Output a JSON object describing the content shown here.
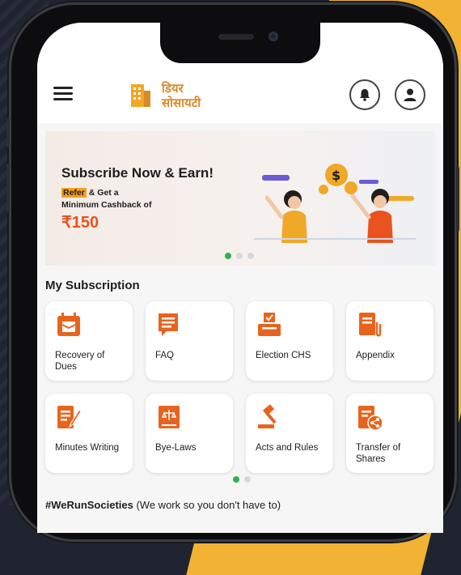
{
  "app": {
    "logo_line1": "डियर",
    "logo_line2": "सोसायटी"
  },
  "banner": {
    "title": "Subscribe Now & Earn!",
    "refer_label": "Refer",
    "line1_rest": " & Get a",
    "line2": "Minimum Cashback of",
    "amount": "₹150"
  },
  "subscription": {
    "heading": "My Subscription",
    "tiles": [
      {
        "label": "Recovery of Dues",
        "icon": "box-calendar-icon"
      },
      {
        "label": "FAQ",
        "icon": "chat-list-icon"
      },
      {
        "label": "Election CHS",
        "icon": "ballot-box-icon"
      },
      {
        "label": "Appendix",
        "icon": "document-clip-icon"
      },
      {
        "label": "Minutes Writing",
        "icon": "document-pen-icon"
      },
      {
        "label": "Bye-Laws",
        "icon": "law-book-icon"
      },
      {
        "label": "Acts and Rules",
        "icon": "gavel-icon"
      },
      {
        "label": "Transfer of Shares",
        "icon": "document-share-icon"
      }
    ]
  },
  "footer": {
    "hashtag": "#WeRunSocieties",
    "note": " (We work so you don't have to)"
  },
  "colors": {
    "accent": "#e8641e",
    "pagination_active": "#2fb34d",
    "brand_gold": "#d9892a"
  }
}
